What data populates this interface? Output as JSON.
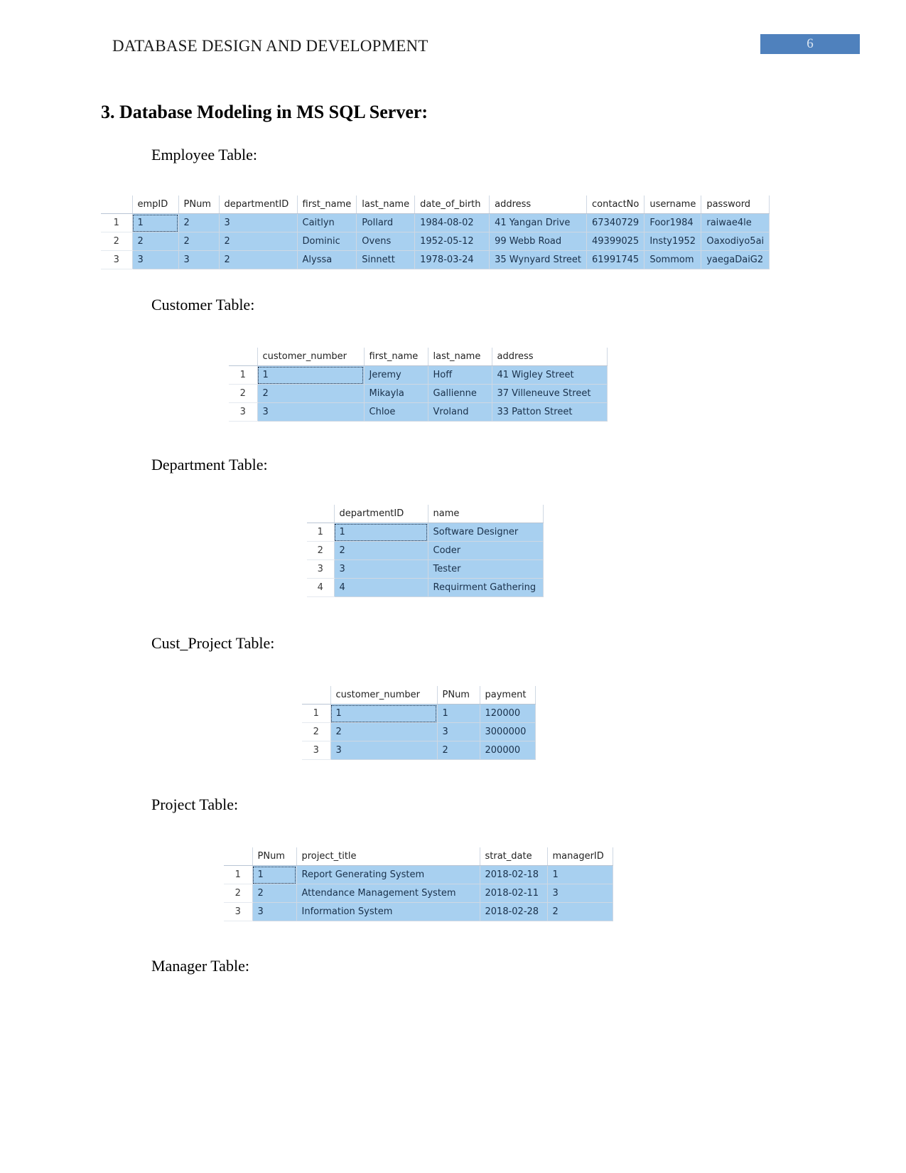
{
  "header": {
    "title": "DATABASE DESIGN AND DEVELOPMENT",
    "page_number": "6",
    "accent_color": "#4f81bd"
  },
  "section": {
    "heading": "3. Database Modeling in MS SQL Server:"
  },
  "captions": {
    "employee": "Employee Table:",
    "customer": "Customer Table:",
    "department": "Department Table:",
    "cust_project": "Cust_Project Table:",
    "project": "Project Table:",
    "manager": "Manager Table:"
  },
  "tables": {
    "employee": {
      "row_headers": [
        "1",
        "2",
        "3"
      ],
      "columns": [
        "empID",
        "PNum",
        "departmentID",
        "first_name",
        "last_name",
        "date_of_birth",
        "address",
        "contactNo",
        "username",
        "password"
      ],
      "rows": [
        [
          "1",
          "2",
          "3",
          "Caitlyn",
          "Pollard",
          "1984-08-02",
          "41 Yangan Drive",
          "67340729",
          "Foor1984",
          "raiwae4le"
        ],
        [
          "2",
          "2",
          "2",
          "Dominic",
          "Ovens",
          "1952-05-12",
          "99 Webb Road",
          "49399025",
          "Insty1952",
          "Oaxodiyo5ai"
        ],
        [
          "3",
          "3",
          "2",
          "Alyssa",
          "Sinnett",
          "1978-03-24",
          "35 Wynyard Street",
          "61991745",
          "Sommom",
          "yaegaDaiG2"
        ]
      ]
    },
    "customer": {
      "row_headers": [
        "1",
        "2",
        "3"
      ],
      "columns": [
        "customer_number",
        "first_name",
        "last_name",
        "address"
      ],
      "rows": [
        [
          "1",
          "Jeremy",
          "Hoff",
          "41 Wigley Street"
        ],
        [
          "2",
          "Mikayla",
          "Gallienne",
          "37 Villeneuve Street"
        ],
        [
          "3",
          "Chloe",
          "Vroland",
          "33 Patton Street"
        ]
      ]
    },
    "department": {
      "row_headers": [
        "1",
        "2",
        "3",
        "4"
      ],
      "columns": [
        "departmentID",
        "name"
      ],
      "rows": [
        [
          "1",
          "Software Designer"
        ],
        [
          "2",
          "Coder"
        ],
        [
          "3",
          "Tester"
        ],
        [
          "4",
          "Requirment Gathering"
        ]
      ]
    },
    "cust_project": {
      "row_headers": [
        "1",
        "2",
        "3"
      ],
      "columns": [
        "customer_number",
        "PNum",
        "payment"
      ],
      "rows": [
        [
          "1",
          "1",
          "120000"
        ],
        [
          "2",
          "3",
          "3000000"
        ],
        [
          "3",
          "2",
          "200000"
        ]
      ]
    },
    "project": {
      "row_headers": [
        "1",
        "2",
        "3"
      ],
      "columns": [
        "PNum",
        "project_title",
        "strat_date",
        "managerID"
      ],
      "rows": [
        [
          "1",
          "Report Generating System",
          "2018-02-18",
          "1"
        ],
        [
          "2",
          "Attendance Management System",
          "2018-02-11",
          "3"
        ],
        [
          "3",
          "Information System",
          "2018-02-28",
          "2"
        ]
      ]
    }
  }
}
